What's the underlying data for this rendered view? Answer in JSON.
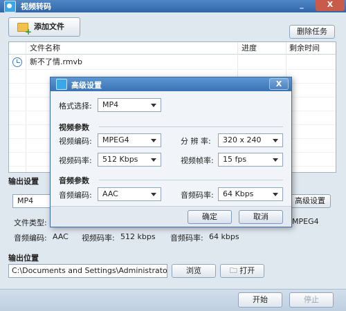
{
  "window": {
    "title": "视频转码",
    "min": "_",
    "close": "X"
  },
  "toolbar": {
    "add_file": "添加文件",
    "delete_task": "删除任务"
  },
  "filelist": {
    "columns": [
      "文件名称",
      "进度",
      "剩余时间"
    ],
    "rows": [
      {
        "name": "新不了情.rmvb",
        "progress": "",
        "remaining": ""
      }
    ]
  },
  "output": {
    "section_title": "输出设置",
    "format_value": "MP4",
    "advanced_button": "高级设置",
    "file_type_label": "文件类型:",
    "file_type_value_right": "MPEG4",
    "audio_codec_label": "音频编码:",
    "audio_codec_value": "AAC",
    "video_bitrate_label": "视频码率:",
    "video_bitrate_value": "512 kbps",
    "audio_bitrate_label": "音频码率:",
    "audio_bitrate_value": "64 kbps"
  },
  "location": {
    "section_title": "输出位置",
    "path": "C:\\Documents and Settings\\Administrator\\桌面",
    "browse": "浏览",
    "open": "打开"
  },
  "actions": {
    "start": "开始",
    "stop": "停止"
  },
  "dialog": {
    "title": "高级设置",
    "close": "X",
    "format_label": "格式选择:",
    "format_value": "MP4",
    "video_group": "视频参数",
    "video_codec_label": "视频编码:",
    "video_codec_value": "MPEG4",
    "resolution_label": "分 辨 率:",
    "resolution_value": "320 x 240",
    "video_bitrate_label": "视频码率:",
    "video_bitrate_value": "512 Kbps",
    "framerate_label": "视频帧率:",
    "framerate_value": "15 fps",
    "audio_group": "音频参数",
    "audio_codec_label": "音频编码:",
    "audio_codec_value": "AAC",
    "audio_bitrate_label": "音频码率:",
    "audio_bitrate_value": "64 Kbps",
    "ok": "确定",
    "cancel": "取消"
  }
}
